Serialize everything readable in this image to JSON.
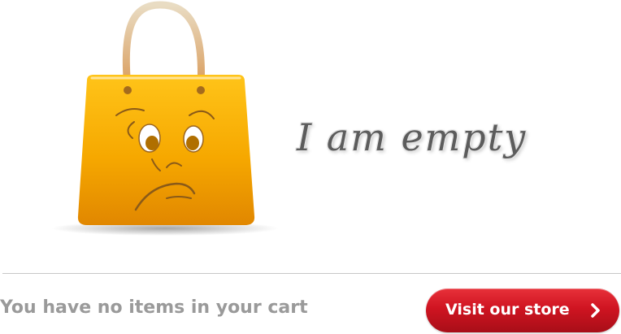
{
  "empty_state": {
    "title": "I am empty",
    "message": "You have no items in your cart",
    "illustration_icon": "sad-shopping-bag-icon"
  },
  "actions": {
    "store_button_label": "Visit our store",
    "store_button_icon": "chevron-right-icon"
  },
  "colors": {
    "bag": "#f5a500",
    "button": "#cf1421",
    "message_text": "#9a9a9a"
  }
}
